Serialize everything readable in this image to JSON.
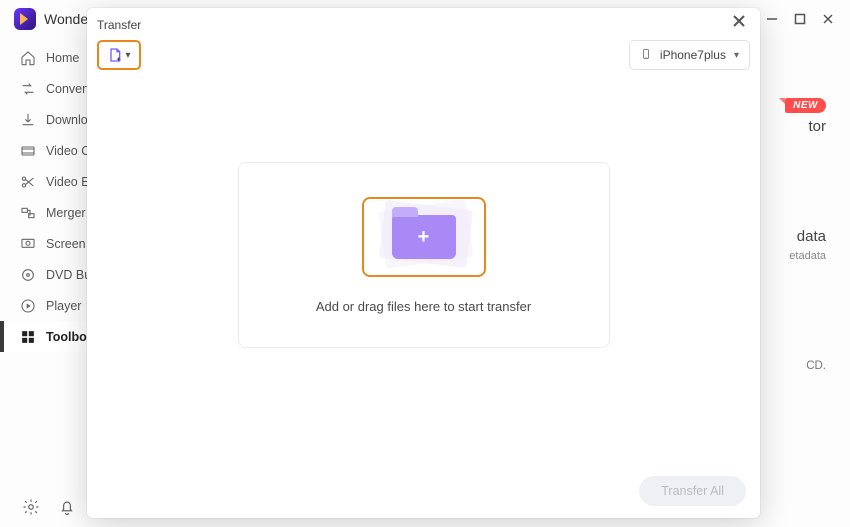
{
  "title": "Wondershare",
  "sidebar": {
    "items": [
      {
        "label": "Home",
        "icon": "home"
      },
      {
        "label": "Converter",
        "icon": "convert"
      },
      {
        "label": "Downloader",
        "icon": "download"
      },
      {
        "label": "Video Compressor",
        "icon": "compress"
      },
      {
        "label": "Video Editor",
        "icon": "scissors"
      },
      {
        "label": "Merger",
        "icon": "merge"
      },
      {
        "label": "Screen Recorder",
        "icon": "record"
      },
      {
        "label": "DVD Burner",
        "icon": "disc"
      },
      {
        "label": "Player",
        "icon": "play"
      },
      {
        "label": "Toolbox",
        "icon": "grid"
      }
    ]
  },
  "background": {
    "badge": "NEW",
    "editor_fragment": "tor",
    "data_fragment": "data",
    "etadata_fragment": "etadata",
    "cd_fragment": "CD."
  },
  "modal": {
    "title": "Transfer",
    "device": "iPhone7plus",
    "drop_text": "Add or drag files here to start transfer",
    "transfer_button": "Transfer All"
  }
}
